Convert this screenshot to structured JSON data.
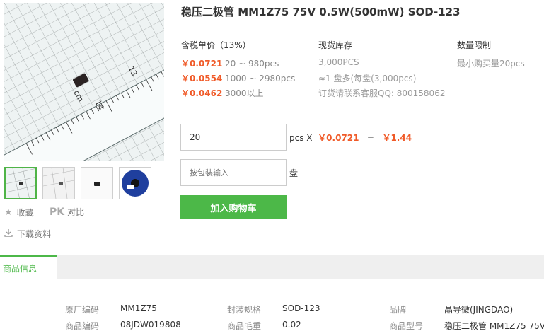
{
  "product": {
    "title": "稳压二极管 MM1Z75 75V 0.5W(500mW) SOD-123"
  },
  "gallery": {
    "thumbnails": [
      "thumb-1",
      "thumb-2",
      "thumb-3",
      "thumb-4"
    ],
    "ruler_numbers": [
      "14",
      "13",
      "cm"
    ]
  },
  "side_actions": {
    "favorite_label": "收藏",
    "pk_badge": "PK",
    "compare_label": "对比",
    "download_label": "下载资料"
  },
  "pricing": {
    "header": "含税单价（13%）",
    "tiers": [
      {
        "price": "￥0.0721",
        "range": "20 ~ 980pcs"
      },
      {
        "price": "￥0.0554",
        "range": "1000 ~ 2980pcs"
      },
      {
        "price": "￥0.0462",
        "range": "3000以上"
      }
    ]
  },
  "stock": {
    "header": "现货库存",
    "quantity": "3,000PCS",
    "reel_note": "≈1 盘多(每盘(3,000pcs)",
    "contact_note": "订货请联系客服QQ: 800158062"
  },
  "limit": {
    "header": "数量限制",
    "min_order": "最小购买量20pcs"
  },
  "order": {
    "quantity_value": "20",
    "unit_text": "pcs X",
    "unit_price": "￥0.0721",
    "equals": "=",
    "total": "￥1.44",
    "pack_placeholder": "按包装输入",
    "pack_unit": "盘",
    "add_to_cart": "加入购物车"
  },
  "tabs": {
    "active": "商品信息"
  },
  "specs": {
    "rows": [
      [
        {
          "label": "原厂编码",
          "value": "MM1Z75"
        },
        {
          "label": "封装规格",
          "value": "SOD-123"
        },
        {
          "label": "品牌",
          "value": "晶导微(JINGDAO)"
        }
      ],
      [
        {
          "label": "商品编码",
          "value": "08JDW019808"
        },
        {
          "label": "商品毛重",
          "value": "0.02"
        },
        {
          "label": "商品型号",
          "value": "稳压二极管 MM1Z75 75V..."
        }
      ]
    ]
  },
  "colors": {
    "accent_green": "#4cb848",
    "price_orange": "#f05a28"
  }
}
